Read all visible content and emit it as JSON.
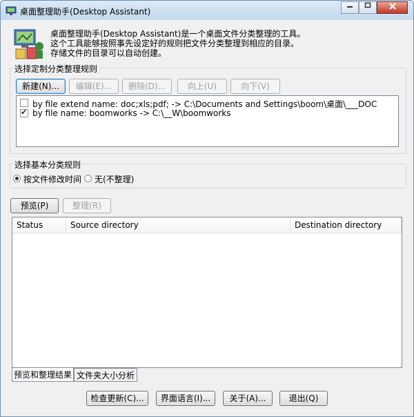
{
  "window": {
    "title": "桌面整理助手(Desktop Assistant)"
  },
  "description": {
    "line1": "桌面整理助手(Desktop Assistant)是一个桌面文件分类整理的工具。",
    "line2": "这个工具能够按照事先设定好的规则把文件分类整理到相应的目录。",
    "line3": "存储文件的目录可以自动创建。"
  },
  "custom_rules": {
    "group_label": "选择定制分类整理规则",
    "buttons": {
      "new": "新建(N)...",
      "edit": "编辑(E)...",
      "delete": "删除(D)...",
      "up": "向上(U)",
      "down": "向下(V)"
    },
    "rules": [
      {
        "label": "by file extend name: doc;xls;pdf; -> C:\\Documents and Settings\\boom\\桌面\\___DOC",
        "checked": false
      },
      {
        "label": "by file name: boomworks -> C:\\__W\\boomworks",
        "checked": true
      }
    ]
  },
  "basic_rules": {
    "group_label": "选择基本分类规则",
    "options": [
      {
        "label": "按文件修改时间",
        "selected": true
      },
      {
        "label": "无(不整理)",
        "selected": false
      }
    ]
  },
  "actions": {
    "preview": "预览(P)",
    "organize": "整理(R)"
  },
  "results": {
    "columns": [
      "Status",
      "Source directory",
      "Destination directory"
    ]
  },
  "tabs": [
    {
      "label": "预览和整理结果",
      "active": true
    },
    {
      "label": "文件夹大小分析",
      "active": false
    }
  ],
  "footer": {
    "check_update": "检查更新(C)...",
    "language": "界面语言(I)...",
    "about": "关于(A)...",
    "exit": "退出(Q)"
  }
}
